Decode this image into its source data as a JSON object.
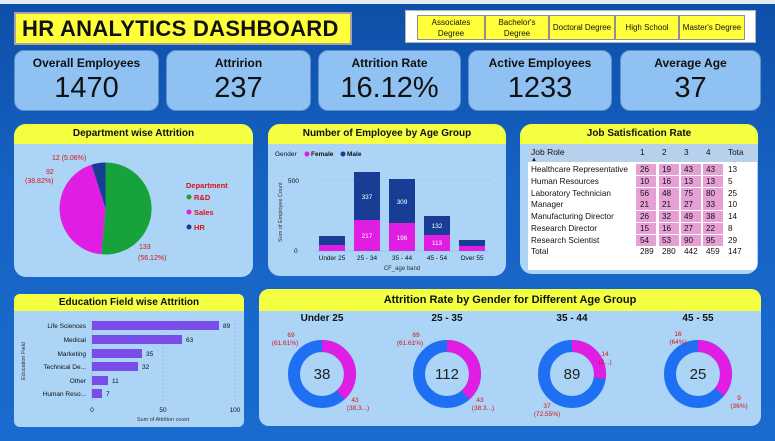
{
  "header": {
    "title": "HR ANALYTICS DASHBOARD"
  },
  "slicer": {
    "items": [
      "Associates Degree",
      "Bachelor's Degree",
      "Doctoral Degree",
      "High School",
      "Master's Degree"
    ]
  },
  "kpis": [
    {
      "label": "Overall Employees",
      "value": "1470"
    },
    {
      "label": "Attririon",
      "value": "237"
    },
    {
      "label": "Attrition Rate",
      "value": "16.12%"
    },
    {
      "label": "Active Employees",
      "value": "1233"
    },
    {
      "label": "Average Age",
      "value": "37"
    }
  ],
  "dept": {
    "title": "Department wise Attrition",
    "legend_title": "Department",
    "labels": [
      "12 (5.06%)",
      "92",
      "(38.82%)",
      "133",
      "(56.12%)"
    ],
    "legend": [
      "R&D",
      "Sales",
      "HR"
    ],
    "colors": {
      "rd": "#16a33c",
      "sales": "#e01de3",
      "hr": "#183d95"
    }
  },
  "age": {
    "title": "Number of Employee by Age Group",
    "legend_label": "Gender",
    "legend": [
      "Female",
      "Male"
    ],
    "ylabel": "Sum of Employee Count",
    "xlabel": "CF_age band",
    "yticks": [
      "500",
      "0"
    ],
    "cats": [
      "Under 25",
      "25 - 34",
      "35 - 44",
      "45 - 54",
      "Over 55"
    ],
    "female_labels": [
      "",
      "217",
      "196",
      "113",
      ""
    ],
    "male_labels": [
      "",
      "337",
      "309",
      "132",
      ""
    ]
  },
  "job": {
    "title": "Job Satisfication Rate",
    "headers": [
      "Job Role",
      "1",
      "2",
      "3",
      "4",
      "Tota"
    ],
    "rows": [
      [
        "Healthcare Representative",
        "26",
        "19",
        "43",
        "43",
        "13"
      ],
      [
        "Human Resources",
        "10",
        "16",
        "13",
        "13",
        "5"
      ],
      [
        "Laboratory Technician",
        "56",
        "48",
        "75",
        "80",
        "25"
      ],
      [
        "Manager",
        "21",
        "21",
        "27",
        "33",
        "10"
      ],
      [
        "Manufacturing Director",
        "26",
        "32",
        "49",
        "38",
        "14"
      ],
      [
        "Research Director",
        "15",
        "16",
        "27",
        "22",
        "8"
      ],
      [
        "Research Scientist",
        "54",
        "53",
        "90",
        "95",
        "29"
      ]
    ],
    "total": [
      "Total",
      "289",
      "280",
      "442",
      "459",
      "147"
    ]
  },
  "edu": {
    "title": "Education Field wise Attrition",
    "ylabel": "Education Field",
    "xlabel": "Sum of Attrition count",
    "xticks": [
      "0",
      "50",
      "100"
    ],
    "fields": [
      "Life Sciences",
      "Medical",
      "Marketing",
      "Technical De...",
      "Other",
      "Human Reso..."
    ],
    "values": [
      "89",
      "63",
      "35",
      "32",
      "11",
      "7"
    ]
  },
  "gender": {
    "title": "Attrition Rate by Gender for Different Age Group",
    "groups": [
      {
        "name": "Under 25",
        "center": "38",
        "blue_l1": "69",
        "blue_l2": "(61.61%)",
        "pink_l1": "43",
        "pink_l2": "(38.3...)"
      },
      {
        "name": "25 - 35",
        "center": "112",
        "blue_l1": "69",
        "blue_l2": "(61.61%)",
        "pink_l1": "43",
        "pink_l2": "(38.3...)"
      },
      {
        "name": "35 - 44",
        "center": "89",
        "blue_l1": "37",
        "blue_l2": "(72.55%)",
        "pink_l1": "14",
        "pink_l2": "(2...)"
      },
      {
        "name": "45 - 55",
        "center": "25",
        "blue_l1": "16",
        "blue_l2": "(64%)",
        "pink_l1": "9",
        "pink_l2": "(36%)"
      }
    ]
  }
}
